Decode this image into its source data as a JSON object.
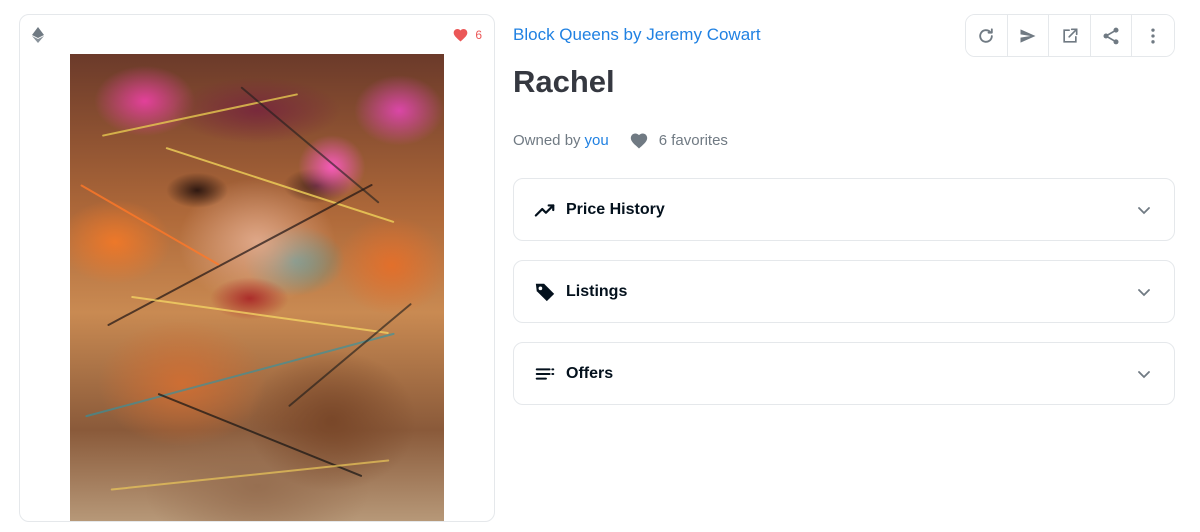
{
  "media": {
    "favorite_count": "6",
    "icons": {
      "chain": "ethereum-icon",
      "favorite": "heart-icon"
    },
    "colors": {
      "favorite": "#eb5757"
    }
  },
  "item": {
    "collection_name": "Block Queens by Jeremy Cowart",
    "title": "Rachel",
    "owned_by_label": "Owned by",
    "owner_name": "you",
    "favorites_label": "6 favorites"
  },
  "toolbar": {
    "buttons": [
      {
        "icon": "refresh-icon"
      },
      {
        "icon": "send-icon"
      },
      {
        "icon": "external-link-icon"
      },
      {
        "icon": "share-icon"
      },
      {
        "icon": "more-vertical-icon"
      }
    ]
  },
  "sections": [
    {
      "label": "Price History",
      "icon": "trending-icon"
    },
    {
      "label": "Listings",
      "icon": "tag-icon"
    },
    {
      "label": "Offers",
      "icon": "list-icon"
    }
  ],
  "colors": {
    "link": "#2081e2",
    "text_primary": "#353840",
    "text_secondary": "#707a83",
    "border": "#e5e8eb"
  }
}
